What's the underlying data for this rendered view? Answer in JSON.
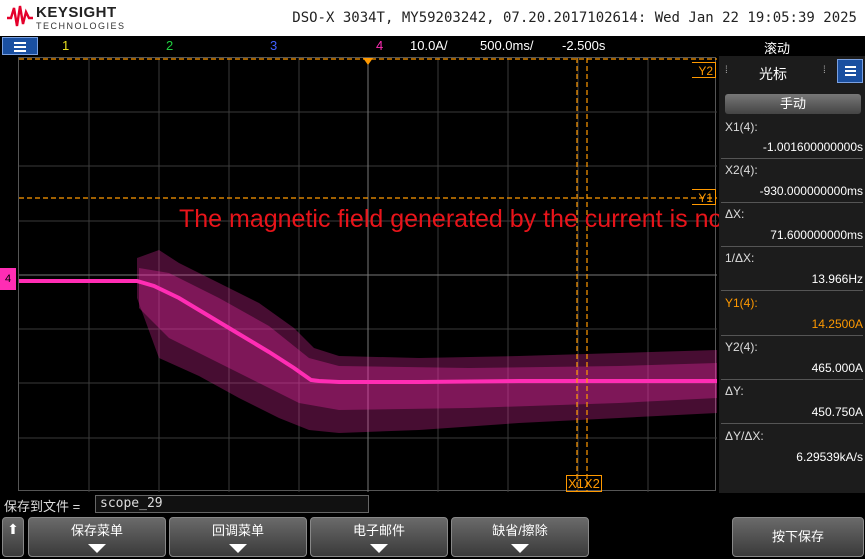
{
  "header": {
    "brand": "KEYSIGHT",
    "brand_sub": "TECHNOLOGIES",
    "device_info": "DSO-X 3034T, MY59203242, 07.20.2017102614: Wed Jan 22 19:05:39 2025"
  },
  "channel_bar": {
    "ch1": "1",
    "ch2": "2",
    "ch3": "3",
    "ch4": "4",
    "scale": "10.0A/",
    "timebase": "500.0ms/",
    "delay": "-2.500s",
    "trigger_mode": "滚动"
  },
  "markers": {
    "y2": "Y2",
    "y1": "Y1",
    "x1x2": "X1X2",
    "ch4": "4"
  },
  "annotation": "The magnetic field generated by the current is not rotating.",
  "cursor_panel": {
    "title": "光标",
    "mode": "手动",
    "x1_label": "X1(4):",
    "x1_value": "-1.001600000000s",
    "x2_label": "X2(4):",
    "x2_value": "-930.000000000ms",
    "dx_label": "ΔX:",
    "dx_value": "71.600000000ms",
    "inv_dx_label": "1/ΔX:",
    "inv_dx_value": "13.966Hz",
    "y1_label": "Y1(4):",
    "y1_value": "14.2500A",
    "y2_label": "Y2(4):",
    "y2_value": "465.000A",
    "dy_label": "ΔY:",
    "dy_value": "450.750A",
    "dydx_label": "ΔY/ΔX:",
    "dydx_value": "6.29539kA/s"
  },
  "bottom": {
    "save_to_file_label": "保存到文件 =",
    "filename": "scope_29",
    "softkeys": [
      "保存菜单",
      "回调菜单",
      "电子邮件",
      "缺省/擦除"
    ],
    "press_save": "按下保存"
  },
  "colors": {
    "ch1": "#e8e020",
    "ch2": "#20d040",
    "ch3": "#4060ff",
    "ch4": "#ff2db4",
    "cursor": "#ff9900",
    "annotation": "#e8141a"
  }
}
